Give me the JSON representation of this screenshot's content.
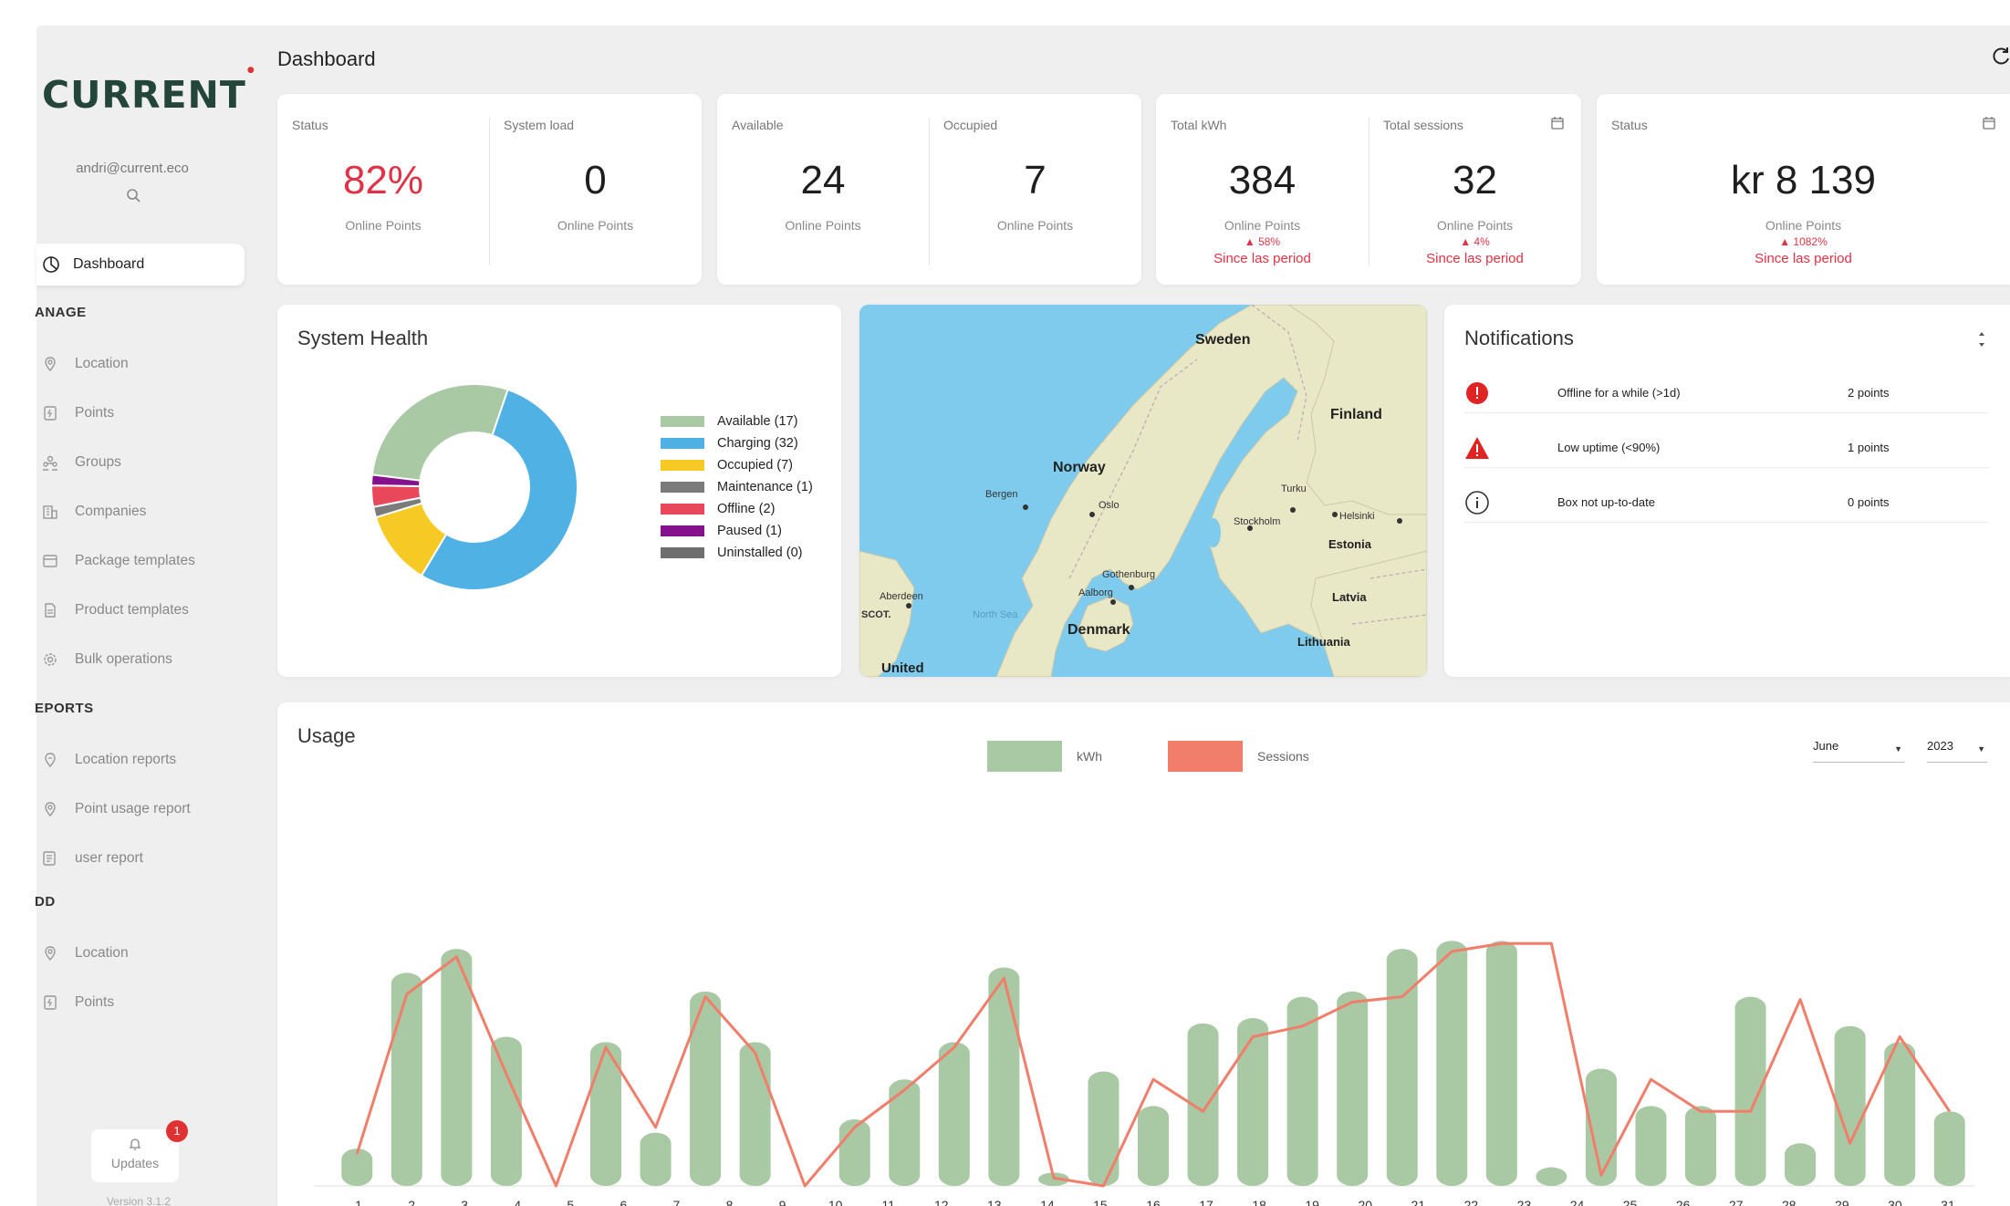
{
  "app": {
    "logo": "CURRENT",
    "user_email": "andri@current.eco",
    "page_title": "Dashboard",
    "version": "Version 3.1.2"
  },
  "sidebar": {
    "active_item": "Dashboard",
    "sections": [
      {
        "heading": "ANAGE",
        "items": [
          "Location",
          "Points",
          "Groups",
          "Companies",
          "Package templates",
          "Product templates",
          "Bulk operations"
        ]
      },
      {
        "heading": "EPORTS",
        "items": [
          "Location reports",
          "Point usage report",
          "user report"
        ]
      },
      {
        "heading": "DD",
        "items": [
          "Location",
          "Points"
        ]
      }
    ],
    "updates_label": "Updates",
    "updates_badge": "1"
  },
  "stats": {
    "status": {
      "label": "Status",
      "value": "82%",
      "sub": "Online Points"
    },
    "system_load": {
      "label": "System load",
      "value": "0",
      "sub": "Online Points"
    },
    "available": {
      "label": "Available",
      "value": "24",
      "sub": "Online Points"
    },
    "occupied": {
      "label": "Occupied",
      "value": "7",
      "sub": "Online Points"
    },
    "total_kwh": {
      "label": "Total kWh",
      "value": "384",
      "sub": "Online Points",
      "delta": "▲ 58%",
      "since": "Since las period"
    },
    "total_sessions": {
      "label": "Total sessions",
      "value": "32",
      "sub": "Online Points",
      "delta": "▲ 4%",
      "since": "Since las period"
    },
    "revenue": {
      "label": "Status",
      "value": "kr 8 139",
      "sub": "Online Points",
      "delta": "▲ 1082%",
      "since": "Since las period"
    }
  },
  "system_health": {
    "title": "System Health",
    "legend": [
      {
        "label": "Available (17)",
        "value": 17,
        "color": "#a9c8a4"
      },
      {
        "label": "Charging (32)",
        "value": 32,
        "color": "#4fb1e4"
      },
      {
        "label": "Occupied (7)",
        "value": 7,
        "color": "#f6c925"
      },
      {
        "label": "Maintenance (1)",
        "value": 1,
        "color": "#7b7b7b"
      },
      {
        "label": "Offline (2)",
        "value": 2,
        "color": "#e9485b"
      },
      {
        "label": "Paused (1)",
        "value": 1,
        "color": "#86118c"
      },
      {
        "label": "Uninstalled (0)",
        "value": 0,
        "color": "#6e6e6e"
      }
    ]
  },
  "map": {
    "countries": [
      "Sweden",
      "Finland",
      "Norway",
      "Estonia",
      "Latvia",
      "Denmark",
      "Lithuania",
      "United"
    ],
    "cities": [
      "Bergen",
      "Oslo",
      "Turku",
      "Helsinki",
      "Stockholm",
      "Gothenburg",
      "Aalborg",
      "Aberdeen",
      "SCOT.",
      "North Sea"
    ]
  },
  "notifications": {
    "title": "Notifications",
    "items": [
      {
        "icon": "error-icon",
        "message": "Offline for a while (>1d)",
        "count": "2 points"
      },
      {
        "icon": "warning-icon",
        "message": "Low uptime (<90%)",
        "count": "1 points"
      },
      {
        "icon": "info-icon",
        "message": "Box not up-to-date",
        "count": "0 points"
      }
    ]
  },
  "usage": {
    "title": "Usage",
    "legend_kwh": "kWh",
    "legend_sessions": "Sessions",
    "month": "June",
    "year": "2023"
  },
  "chart_data": {
    "type": "bar",
    "categories": [
      "1",
      "2",
      "3",
      "4",
      "5",
      "6",
      "7",
      "8",
      "9",
      "10",
      "11",
      "12",
      "13",
      "14",
      "15",
      "16",
      "17",
      "18",
      "19",
      "20",
      "21",
      "22",
      "23",
      "24",
      "25",
      "26",
      "27",
      "28",
      "29",
      "30",
      "31"
    ],
    "series": [
      {
        "name": "kWh",
        "type": "bar",
        "color": "#a9c8a4",
        "values": [
          14,
          80,
          89,
          56,
          0,
          54,
          20,
          73,
          54,
          0,
          25,
          40,
          54,
          82,
          5,
          43,
          30,
          61,
          63,
          71,
          73,
          89,
          92,
          92,
          7,
          44,
          30,
          30,
          71,
          16,
          60,
          54,
          28
        ]
      },
      {
        "name": "Sessions",
        "type": "line",
        "color": "#f07e6b",
        "values": [
          12,
          72,
          86,
          42,
          0,
          52,
          22,
          71,
          50,
          0,
          22,
          36,
          52,
          78,
          3,
          0,
          40,
          28,
          56,
          60,
          69,
          71,
          88,
          91,
          91,
          4,
          40,
          28,
          28,
          70,
          16,
          56,
          28
        ]
      }
    ],
    "ylim": [
      0,
      100
    ]
  }
}
